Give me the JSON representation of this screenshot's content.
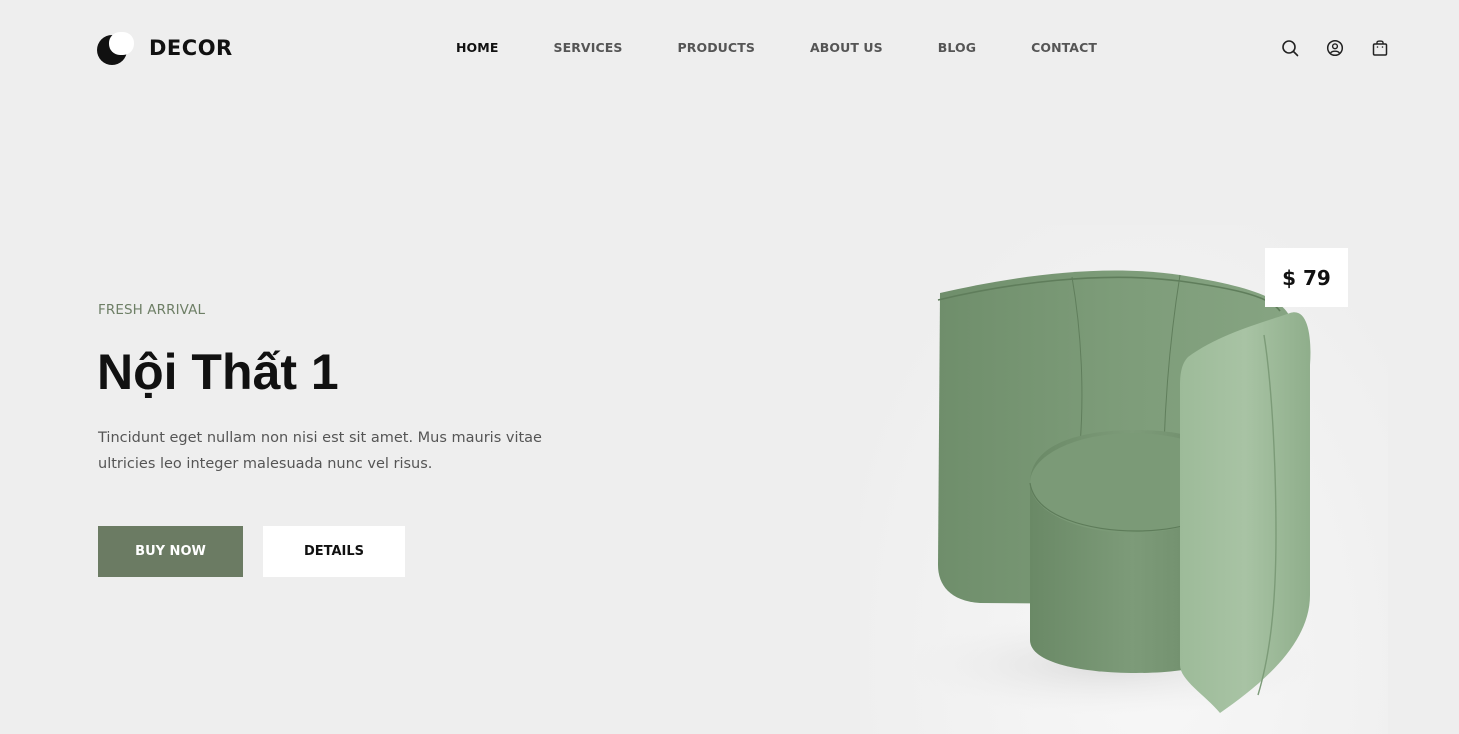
{
  "brand": {
    "name": "DECOR"
  },
  "nav": {
    "items": [
      {
        "label": "HOME",
        "active": true
      },
      {
        "label": "SERVICES",
        "active": false
      },
      {
        "label": "PRODUCTS",
        "active": false
      },
      {
        "label": "ABOUT US",
        "active": false
      },
      {
        "label": "BLOG",
        "active": false
      },
      {
        "label": "CONTACT",
        "active": false
      }
    ]
  },
  "header_icons": [
    "search-icon",
    "user-icon",
    "shopping-bag-icon"
  ],
  "hero": {
    "eyebrow": "FRESH ARRIVAL",
    "title": "Nội Thất 1",
    "description": "Tincidunt eget nullam non nisi est sit amet. Mus mauris vitae ultricies leo integer malesuada nunc vel risus.",
    "buy_label": "BUY NOW",
    "details_label": "DETAILS",
    "price": "$ 79"
  },
  "colors": {
    "background": "#eeeeee",
    "accent": "#6b7b63",
    "eyebrow": "#6e7f66",
    "text": "#111111",
    "chair": "#7fa07c"
  }
}
